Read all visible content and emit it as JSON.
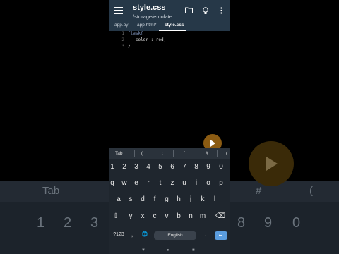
{
  "background": {
    "tab_label": "Tab",
    "hash": "#",
    "paren": "(",
    "digits_left": [
      "1",
      "2",
      "3"
    ],
    "digits_right": [
      "8",
      "9",
      "0"
    ]
  },
  "app": {
    "title": "style.css",
    "subtitle": "/storage/emulate...",
    "tabs": [
      "app.py",
      "app.html*",
      "style.css"
    ]
  },
  "editor": {
    "lines": [
      {
        "num": "1",
        "text": "flask{"
      },
      {
        "num": "2",
        "text": "   color : red;"
      },
      {
        "num": "3",
        "text": "}"
      }
    ]
  },
  "symbols": [
    "Tab",
    "(",
    ":",
    "'",
    "#",
    "("
  ],
  "keyboard": {
    "row_numbers": [
      "1",
      "2",
      "3",
      "4",
      "5",
      "6",
      "7",
      "8",
      "9",
      "0"
    ],
    "row1": [
      "q",
      "w",
      "e",
      "r",
      "t",
      "z",
      "u",
      "i",
      "o",
      "p"
    ],
    "row2": [
      "a",
      "s",
      "d",
      "f",
      "g",
      "h",
      "j",
      "k",
      "l"
    ],
    "row3": [
      "y",
      "x",
      "c",
      "v",
      "b",
      "n",
      "m"
    ],
    "mode_label": "?123",
    "comma": ",",
    "space_label": "English",
    "period": ".",
    "shift": "⇧",
    "backspace": "⌫",
    "globe": "🌐",
    "enter": "↵"
  },
  "colors": {
    "appbar": "#263848",
    "fab": "#8b5b12",
    "enter_key": "#5b9dde"
  }
}
